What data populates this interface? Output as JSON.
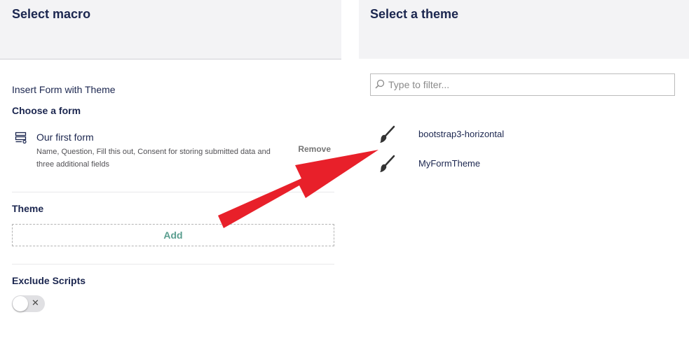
{
  "left": {
    "title": "Select macro",
    "macro_name": "Insert Form with Theme",
    "choose_form_label": "Choose a form",
    "form": {
      "name": "Our first form",
      "description": "Name, Question, Fill this out, Consent for storing submitted data and three additional fields",
      "remove_label": "Remove"
    },
    "theme_label": "Theme",
    "add_label": "Add",
    "exclude_scripts_label": "Exclude Scripts",
    "exclude_scripts_value": false,
    "toggle_off_glyph": "✕"
  },
  "right": {
    "title": "Select a theme",
    "filter_placeholder": "Type to filter...",
    "themes": [
      {
        "label": "bootstrap3-horizontal",
        "icon": "brush-icon"
      },
      {
        "label": "MyFormTheme",
        "icon": "brush-icon"
      }
    ]
  },
  "colors": {
    "header_bg": "#f3f3f5",
    "text": "#1b264f",
    "add_accent": "#5a9e8f",
    "arrow": "#e8202a"
  }
}
